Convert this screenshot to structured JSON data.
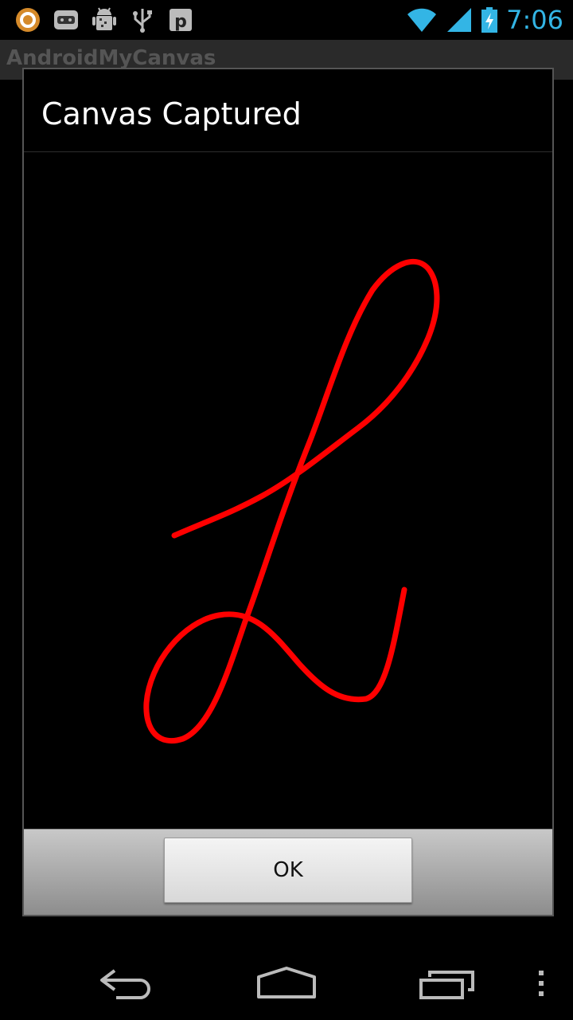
{
  "status_bar": {
    "time": "7:06",
    "icons": [
      "app-notification-icon",
      "game-controller-icon",
      "android-debug-icon",
      "usb-icon",
      "p-app-icon"
    ],
    "right_icons": [
      "wifi-icon",
      "signal-icon",
      "battery-charging-icon"
    ]
  },
  "app": {
    "title": "AndroidMyCanvas"
  },
  "dialog": {
    "title": "Canvas Captured",
    "ok_label": "OK",
    "stroke_color": "#ff0000"
  },
  "nav_bar": {
    "icons": [
      "back-icon",
      "home-icon",
      "recent-apps-icon",
      "overflow-menu-icon"
    ]
  }
}
